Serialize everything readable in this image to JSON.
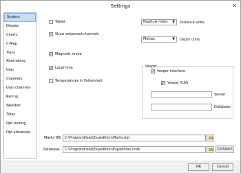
{
  "window": {
    "title": "Settings",
    "close_glyph": "✕"
  },
  "sidebar": {
    "items": [
      {
        "label": "System",
        "selected": true
      },
      {
        "label": "Display"
      },
      {
        "label": "Charts"
      },
      {
        "label": "C-Map"
      },
      {
        "label": "Track"
      },
      {
        "label": "Alternating"
      },
      {
        "label": "User"
      },
      {
        "label": "Channels"
      },
      {
        "label": "User channels"
      },
      {
        "label": "Racing"
      },
      {
        "label": "Weather"
      },
      {
        "label": "Tides"
      },
      {
        "label": "Opt routing"
      },
      {
        "label": "Opt advanced"
      }
    ]
  },
  "system": {
    "tablet": {
      "label": "Tablet",
      "checked": false
    },
    "show_advanced_channels": {
      "label": "Show advanced channels",
      "checked": true
    },
    "magnetic_mode": {
      "label": "Magnetic mode",
      "checked": true
    },
    "local_time": {
      "label": "Local time",
      "checked": true
    },
    "temperatures_fahrenheit": {
      "label": "Temperatures in Fahrenheit",
      "checked": false
    },
    "distance_units": {
      "value": "Nautical miles",
      "label": "Distance units"
    },
    "depth_units": {
      "value": "Metres",
      "label": "Depth units"
    },
    "vesper": {
      "title": "Vesper",
      "interface": {
        "label": "Vesper interface",
        "checked": true
      },
      "icas": {
        "label": "Vesper ICAS",
        "checked": true
      },
      "server_label": "Server",
      "server_value": "",
      "database_label": "Database",
      "database_value": ""
    },
    "marks_db": {
      "label": "Marks DB:",
      "value": "C:\\ProgramData\\Expedition\\Marks.dat"
    },
    "database": {
      "label": "Database:",
      "value": "C:\\ProgramData\\Expedition\\Expedition.mdb"
    },
    "compact_label": "Compact"
  },
  "footer": {
    "ok_label": "OK",
    "cancel_label": "Cancel"
  },
  "colors": {
    "selection": "#c6def6",
    "folder": "#e8b84a"
  }
}
